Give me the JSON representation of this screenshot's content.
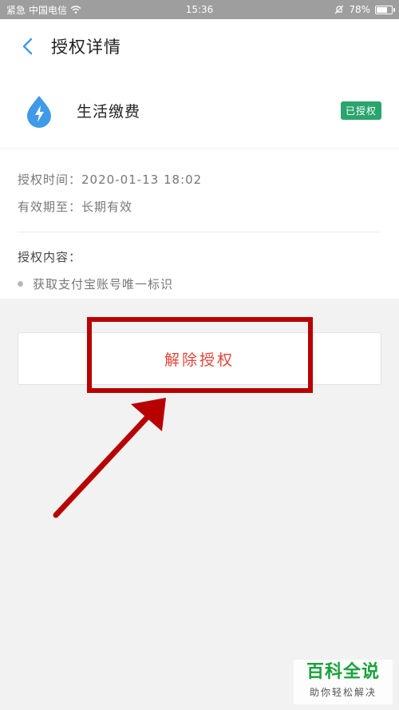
{
  "status_bar": {
    "carrier_signal": "紧急",
    "carrier": "中国电信",
    "time": "15:36",
    "battery": "78%",
    "battery_level": 0.78
  },
  "nav": {
    "title": "授权详情"
  },
  "app": {
    "name": "生活缴费",
    "badge": "已授权",
    "icon_color": "#3f9ae8"
  },
  "info": {
    "auth_time": "授权时间：2020-01-13 18:02",
    "valid_until": "有效期至：长期有效"
  },
  "scope": {
    "title": "授权内容：",
    "items": [
      "获取支付宝账号唯一标识"
    ]
  },
  "actions": {
    "revoke_label": "解除授权"
  },
  "watermark": {
    "main": "百科全说",
    "sub": "助你轻松解决"
  },
  "colors": {
    "accent_blue": "#3f9ae8",
    "badge_green": "#2aa56d",
    "revoke_red": "#e2463a",
    "annotation_red": "#b80000"
  }
}
